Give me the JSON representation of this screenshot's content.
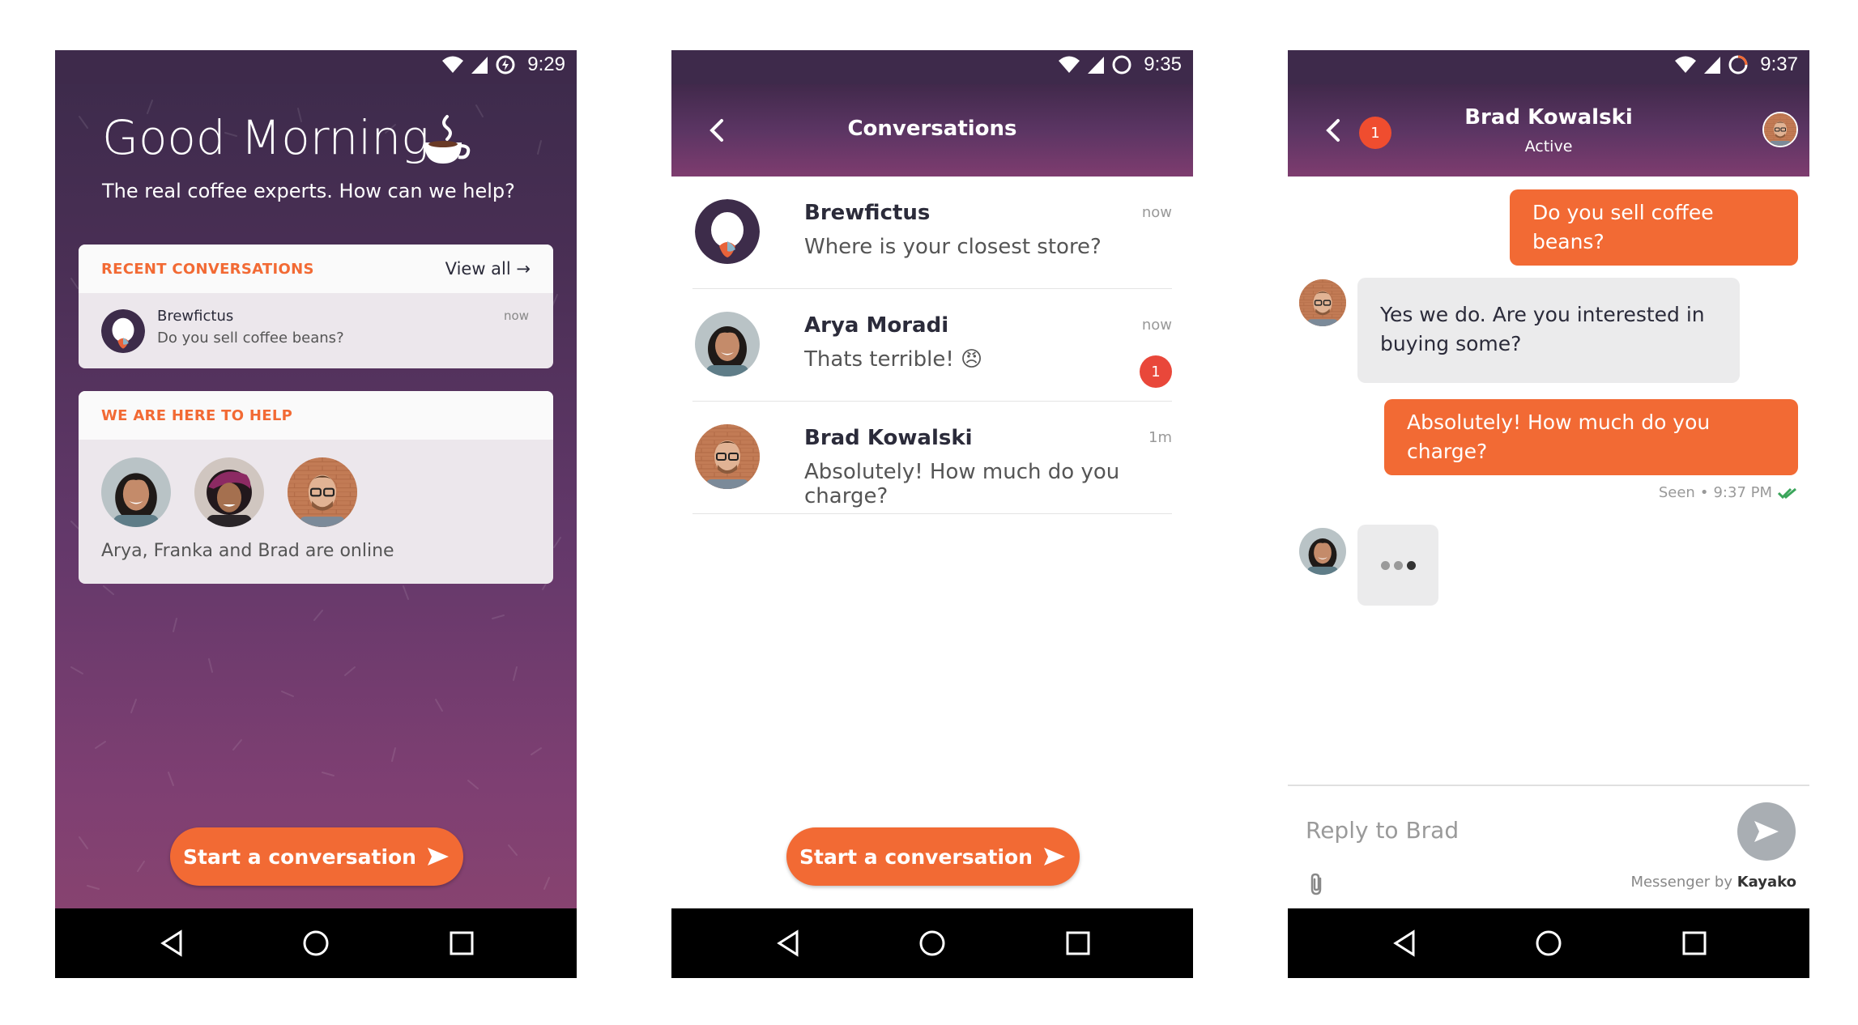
{
  "screen1": {
    "time": "9:29",
    "greeting": "Good Morning",
    "subtitle": "The real coffee experts. How can we help?",
    "recent": {
      "label": "RECENT CONVERSATIONS",
      "view_all": "View all →",
      "item": {
        "name": "Brewfictus",
        "message": "Do you sell coffee beans?",
        "time": "now"
      }
    },
    "help": {
      "label": "WE ARE HERE TO HELP",
      "online_text": "Arya, Franka and Brad are online"
    },
    "cta": "Start a conversation"
  },
  "screen2": {
    "time": "9:35",
    "title": "Conversations",
    "conversations": [
      {
        "name": "Brewfictus",
        "message": "Where is your closest store?",
        "time": "now"
      },
      {
        "name": "Arya Moradi",
        "message": "Thats terrible! 😠",
        "time": "now",
        "badge": "1"
      },
      {
        "name": "Brad Kowalski",
        "message": "Absolutely! How much do you charge?",
        "time": "1m"
      }
    ],
    "cta": "Start a conversation"
  },
  "screen3": {
    "time": "9:37",
    "contact_name": "Brad Kowalski",
    "contact_status": "Active",
    "unread_badge": "1",
    "messages": [
      {
        "from": "me",
        "text": "Do you sell coffee beans?"
      },
      {
        "from": "them",
        "text": "Yes we do. Are you interested in buying some?"
      },
      {
        "from": "me",
        "text": "Absolutely! How much do you charge?"
      }
    ],
    "seen_label": "Seen",
    "seen_time": "9:37 PM",
    "reply_placeholder": "Reply to Brad",
    "powered_by_prefix": "Messenger by",
    "powered_by_brand": "Kayako"
  },
  "colors": {
    "accent": "#f26a34",
    "header": "#3e2a4b",
    "badge": "#e9473a"
  },
  "icons": [
    "wifi-icon",
    "signal-icon",
    "battery-icon",
    "back-icon",
    "send-icon",
    "paperclip-icon",
    "nav-back-icon",
    "nav-home-icon",
    "nav-recents-icon",
    "coffee-cup-icon",
    "arrow-icon",
    "double-check-icon"
  ]
}
